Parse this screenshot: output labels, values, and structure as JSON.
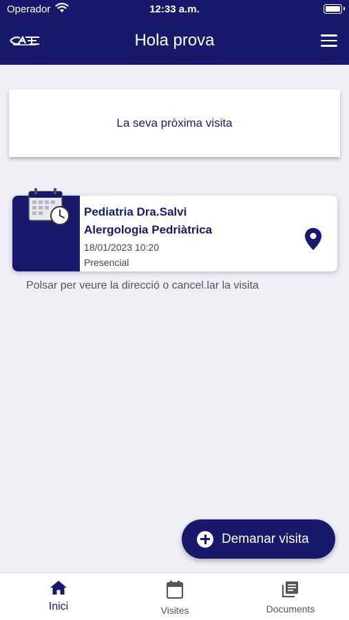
{
  "status_bar": {
    "carrier": "Operador",
    "time": "12:33 a.m."
  },
  "header": {
    "title": "Hola prova",
    "logo_icon": "app-logo",
    "menu_icon": "hamburger-menu-icon"
  },
  "next_visit": {
    "heading": "La seva pròxima visita"
  },
  "visit": {
    "specialty": "Pediatria Dra.Salvi",
    "service": "Alergologia Pedriàtrica",
    "datetime": "18/01/2023 10:20",
    "mode": "Presencial",
    "icon": "calendar-clock-icon",
    "location_icon": "map-pin-icon"
  },
  "hint": "Polsar per veure la direcció o cancel.lar la visita",
  "fab": {
    "label": "Demanar visita",
    "icon": "plus-circle-icon"
  },
  "tabs": [
    {
      "label": "Inici",
      "icon": "home-icon",
      "active": true
    },
    {
      "label": "Visites",
      "icon": "calendar-icon",
      "active": false
    },
    {
      "label": "Documents",
      "icon": "documents-icon",
      "active": false
    }
  ],
  "colors": {
    "primary": "#18196b",
    "background": "#eff0f5",
    "text_muted": "#555555"
  }
}
